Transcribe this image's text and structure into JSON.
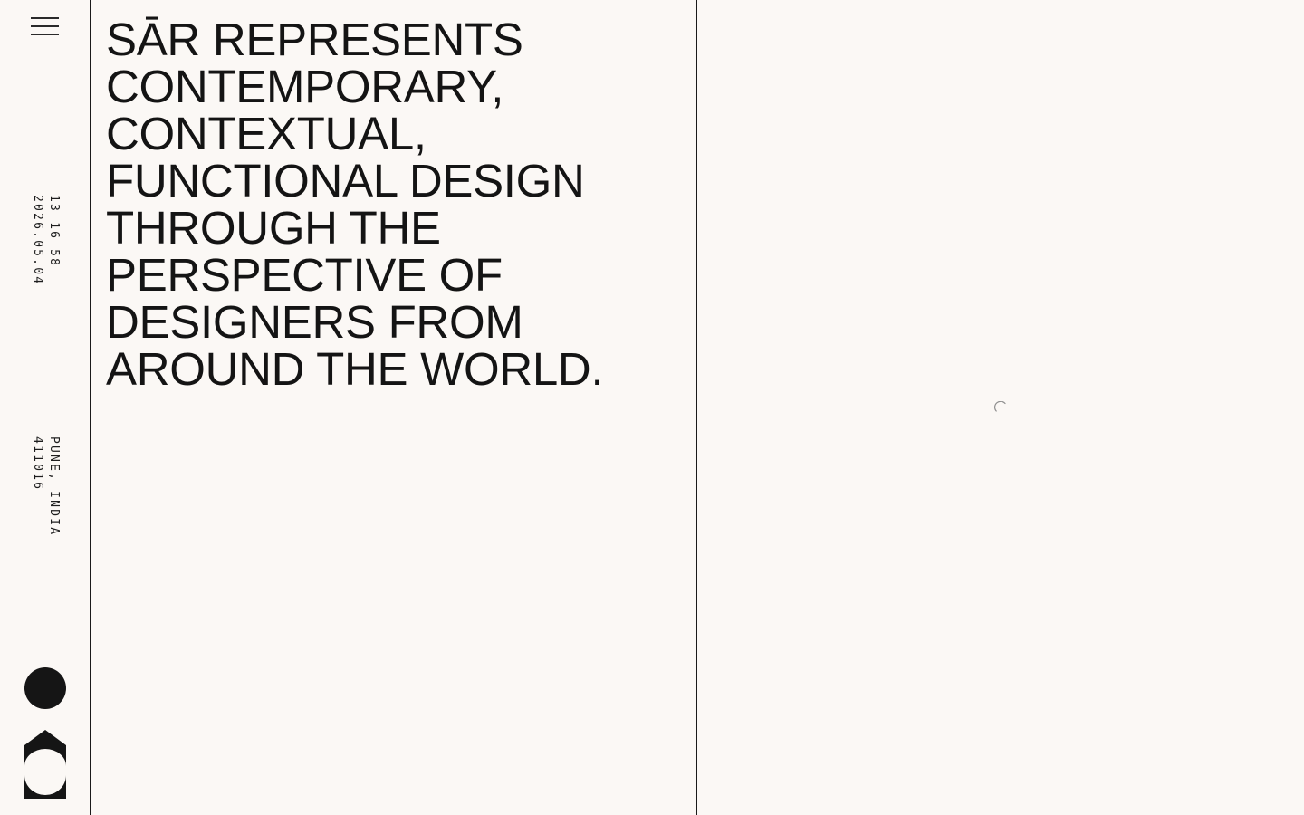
{
  "sidebar": {
    "menu_icon": "hamburger-menu-icon",
    "clock": {
      "time": "13 16 58",
      "date": "2026.05.04"
    },
    "location": {
      "city": "PUNE, INDIA",
      "postcode": "411016"
    },
    "logo_icon": "sar-logo-icon"
  },
  "hero": {
    "headline": "SĀR REPRESENTS CONTEMPORARY, CONTEXTUAL, FUNCTIONAL DESIGN THROUGH THE PERSPECTIVE OF DESIGNERS FROM AROUND THE WORLD."
  },
  "preview": {
    "loading_icon": "loading-spinner-icon"
  },
  "colors": {
    "background": "#fbf8f5",
    "ink": "#141414"
  }
}
